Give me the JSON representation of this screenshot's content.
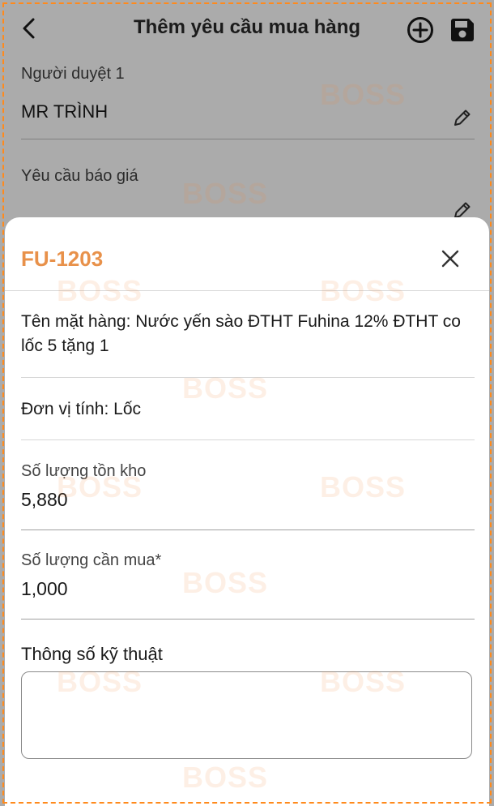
{
  "header": {
    "title": "Thêm yêu cầu mua hàng"
  },
  "form": {
    "approver_label": "Người duyệt 1",
    "approver_value": "MR TRÌNH",
    "quote_label": "Yêu cầu báo giá"
  },
  "sheet": {
    "code": "FU-1203",
    "item_name": "Tên mặt hàng: Nước yến sào  ĐTHT Fuhina 12% ĐTHT co lốc 5 tặng 1",
    "unit": "Đơn vị tính: Lốc",
    "stock_label": "Số lượng tồn kho",
    "stock_value": "5,880",
    "qty_label": "Số lượng cần mua*",
    "qty_value": "1,000",
    "spec_label": "Thông số kỹ thuật",
    "spec_value": ""
  },
  "watermark": {
    "text": "BOSS"
  },
  "colors": {
    "accent": "#e8914a",
    "overlay": "#ababab",
    "frame": "#ff8a1c"
  }
}
